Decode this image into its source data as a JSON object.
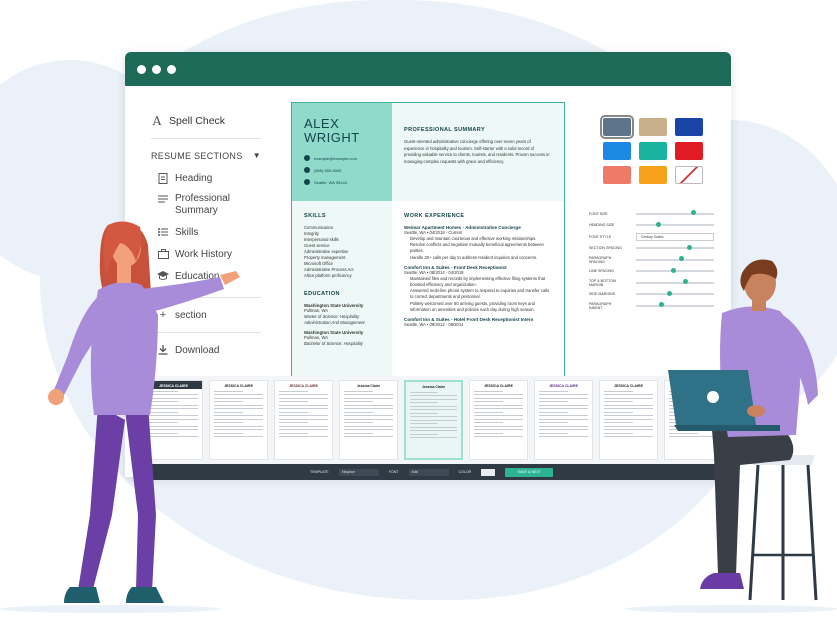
{
  "sidebar": {
    "spell_check": "Spell Check",
    "sections_header": "RESUME SECTIONS",
    "items": [
      "Heading",
      "Professional Summary",
      "Skills",
      "Work History",
      "Education"
    ],
    "add_section": "section",
    "download": "Download"
  },
  "resume": {
    "first_name": "ALEX",
    "last_name": "WRIGHT",
    "email": "example@example.com",
    "phone": "(555) 555-5555",
    "location": "Seattle, WA 98144",
    "summary_title": "PROFESSIONAL SUMMARY",
    "summary_text": "Guest-oriented administrative concierge offering over seven years of experience in hospitality and tourism. Self-starter with a solid record of providing valuable service to clients, tourists, and residents. Proven success in managing complex requests with grace and efficiency.",
    "skills_title": "SKILLS",
    "skills": [
      "Communication",
      "Integrity",
      "Interpersonal skills",
      "Guest service",
      "Administrative expertise",
      "Property management",
      "Microsoft Office",
      "Administrative Process Act",
      "Altice platform proficiency"
    ],
    "education_title": "EDUCATION",
    "education": [
      {
        "school": "Washington State University",
        "location": "Pullman, WA",
        "degree": "Master of Science: Hospitality Administration And Management"
      },
      {
        "school": "Washington State University",
        "location": "Pullman, WA",
        "degree": "Bachelor of Science: Hospitality"
      }
    ],
    "work_title": "WORK EXPERIENCE",
    "jobs": [
      {
        "title": "Weimar Apartment Homes - Administrative Concierge",
        "meta": "Seattle, WA • 04/2018 - Current",
        "bullets": [
          "Develop and maintain courteous and effective working relationships.",
          "Resolve conflicts and negotiate mutually beneficial agreements between parties.",
          "Handle 30+ calls per day to address resident inquiries and concerns."
        ]
      },
      {
        "title": "Comfort Inn & Suites - Front Desk Receptionist",
        "meta": "Seattle, WA • 08/2014 - 04/2018",
        "bullets": [
          "Maintained files and records by implementing effective filing systems that boosted efficiency and organization.",
          "Answered multi-line phone system to respond to inquiries and transfer calls to correct departments and personnel.",
          "Politely welcomed over 60 arriving guests, providing room keys and information on amenities and policies each day during high season."
        ]
      },
      {
        "title": "Comfort Inn & Suites - Hotel Front Desk Receptionist Intern",
        "meta": "Seattle, WA • 09/2012 - 08/2014",
        "bullets": []
      }
    ]
  },
  "swatches": [
    "#5e7589",
    "#c8b08a",
    "#1945a8",
    "#1e88e5",
    "#19b39e",
    "#e01b24",
    "#f07a68",
    "#f6a21a",
    "#ffffff"
  ],
  "controls": [
    {
      "label": "FONT SIZE",
      "value": 0.7
    },
    {
      "label": "HEADING SIZE",
      "value": 0.25
    },
    {
      "label": "FONT STYLE",
      "select": "Century Gothic"
    },
    {
      "label": "SECTION SPACING",
      "value": 0.65
    },
    {
      "label": "PARAGRAPH SPACING",
      "value": 0.55
    },
    {
      "label": "LINE SPACING",
      "value": 0.45
    },
    {
      "label": "TOP & BOTTOM MARGIN",
      "value": 0.6
    },
    {
      "label": "SIDE MARGINS",
      "value": 0.4
    },
    {
      "label": "PARAGRAPH INDENT",
      "value": 0.3
    }
  ],
  "templates": [
    "JESSICA CLAIRE",
    "JESSICA CLAIRE",
    "JESSICA CLAIRE",
    "Jessica Claire",
    "Jessica Claire",
    "JESSICA CLAIRE",
    "JESSICA CLAIRE",
    "JESSICA CLAIRE",
    "Jessica Claire"
  ],
  "bottombar": {
    "template_label": "TEMPLATE",
    "template_value": "Elegance",
    "font_label": "FONT",
    "font_value": "Arial",
    "color_label": "COLOR",
    "save_button": "SAVE & NEXT"
  }
}
